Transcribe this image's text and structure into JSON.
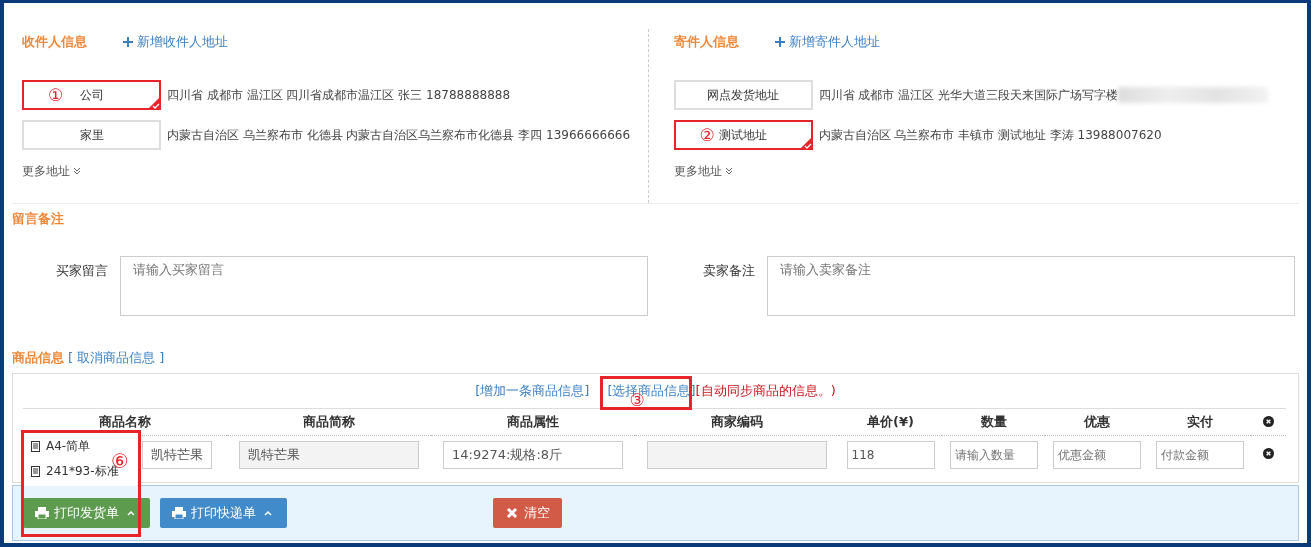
{
  "receiver": {
    "title": "收件人信息",
    "add_link": "新增收件人地址",
    "more": "更多地址",
    "addresses": [
      {
        "label": "公司",
        "text": "四川省 成都市 温江区 四川省成都市温江区 张三 18788888888",
        "selected": true,
        "annotation": "①"
      },
      {
        "label": "家里",
        "text": "内蒙古自治区 乌兰察布市 化德县 内蒙古自治区乌兰察布市化德县 李四 13966666666",
        "selected": false
      }
    ]
  },
  "sender": {
    "title": "寄件人信息",
    "add_link": "新增寄件人地址",
    "more": "更多地址",
    "addresses": [
      {
        "label": "网点发货地址",
        "text": "四川省 成都市 温江区 光华大道三段天来国际广场写字楼",
        "selected": false,
        "blurred": true
      },
      {
        "label": "测试地址",
        "text": "内蒙古自治区 乌兰察布市 丰镇市 测试地址 李涛 13988007620",
        "selected": true,
        "annotation": "②"
      }
    ]
  },
  "remarks": {
    "title": "留言备注",
    "fields": [
      {
        "label": "买家留言",
        "placeholder": "请输入买家留言"
      },
      {
        "label": "卖家备注",
        "placeholder": "请输入卖家备注"
      }
    ]
  },
  "goods": {
    "title": "商品信息",
    "cancel_link": "[ 取消商品信息 ]",
    "add_link": "[增加一条商品信息]",
    "select_link": "[选择商品信息]",
    "select_annotation": "③",
    "sync_note": "[自动同步商品的信息。)",
    "columns": [
      "商品名称",
      "商品简称",
      "商品属性",
      "商家编码",
      "单价(¥)",
      "数量",
      "优惠",
      "实付"
    ],
    "rows": [
      {
        "cells": [
          {
            "value": "凯特芒果",
            "disabled": false
          },
          {
            "value": "凯特芒果",
            "disabled": true
          },
          {
            "value": "14:9274:规格:8斤",
            "disabled": false
          },
          {
            "disabled": true
          },
          {
            "value": "118",
            "disabled": false
          },
          {
            "placeholder": "请输入数量",
            "disabled": false
          },
          {
            "placeholder": "优惠金额",
            "disabled": false
          },
          {
            "placeholder": "付款金额",
            "disabled": false
          }
        ]
      }
    ]
  },
  "footer": {
    "buttons": [
      {
        "label": "打印发货单",
        "kind": "print",
        "color": "#5d9c4f",
        "caret": true,
        "menu_open": true
      },
      {
        "label": "打印快递单",
        "kind": "print",
        "color": "#428bca",
        "caret": true,
        "menu_open": false
      },
      {
        "label": "清空",
        "kind": "clear",
        "color": "#d15b47",
        "caret": false
      }
    ],
    "menu": {
      "items": [
        "A4-简单",
        "241*93-标准"
      ],
      "annotation": "⑥"
    }
  }
}
